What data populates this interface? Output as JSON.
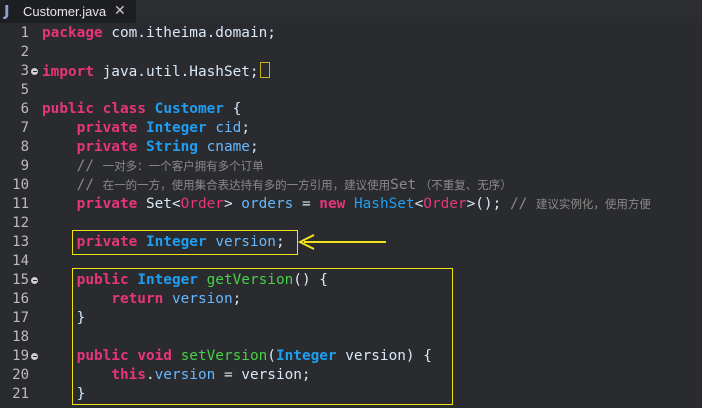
{
  "tab": {
    "icon": "J",
    "icon_name": "java-file-icon",
    "filename": "Customer.java",
    "close": "✕"
  },
  "colors": {
    "keyword": "#e8357a",
    "type": "#1f9ef2",
    "method": "#47d147",
    "comment": "#8a8a8a",
    "highlight": "#f2e21a"
  },
  "lines": [
    {
      "n": "1",
      "fold": false,
      "tokens": [
        {
          "t": "package",
          "c": "kw"
        },
        {
          "t": " com.itheima.domain;",
          "c": ""
        }
      ]
    },
    {
      "n": "2",
      "fold": false,
      "tokens": []
    },
    {
      "n": "3",
      "fold": true,
      "tokens": [
        {
          "t": "import",
          "c": "kw"
        },
        {
          "t": " java.util.HashSet;",
          "c": ""
        }
      ],
      "import_marker": true
    },
    {
      "n": "5",
      "fold": false,
      "tokens": []
    },
    {
      "n": "6",
      "fold": false,
      "tokens": [
        {
          "t": "public",
          "c": "kw"
        },
        {
          "t": " ",
          "c": ""
        },
        {
          "t": "class",
          "c": "kw"
        },
        {
          "t": " ",
          "c": ""
        },
        {
          "t": "Customer",
          "c": "ty-b"
        },
        {
          "t": " {",
          "c": ""
        }
      ]
    },
    {
      "n": "7",
      "fold": false,
      "tokens": [
        {
          "t": "    ",
          "c": ""
        },
        {
          "t": "private",
          "c": "kw"
        },
        {
          "t": " ",
          "c": ""
        },
        {
          "t": "Integer",
          "c": "ty-b"
        },
        {
          "t": " ",
          "c": ""
        },
        {
          "t": "cid",
          "c": "fld"
        },
        {
          "t": ";",
          "c": ""
        }
      ]
    },
    {
      "n": "8",
      "fold": false,
      "tokens": [
        {
          "t": "    ",
          "c": ""
        },
        {
          "t": "private",
          "c": "kw"
        },
        {
          "t": " ",
          "c": ""
        },
        {
          "t": "String",
          "c": "ty-b"
        },
        {
          "t": " ",
          "c": ""
        },
        {
          "t": "cname",
          "c": "fld"
        },
        {
          "t": ";",
          "c": ""
        }
      ]
    },
    {
      "n": "9",
      "fold": false,
      "tokens": [
        {
          "t": "    ",
          "c": ""
        },
        {
          "t": "// ",
          "c": "cm-mono"
        },
        {
          "t": "一对多：一个客户拥有多个订单",
          "c": "cm"
        }
      ]
    },
    {
      "n": "10",
      "fold": false,
      "tokens": [
        {
          "t": "    ",
          "c": ""
        },
        {
          "t": "// ",
          "c": "cm-mono"
        },
        {
          "t": "在一的一方，使用集合表达持有多的一方引用，建议使用",
          "c": "cm"
        },
        {
          "t": "Set",
          "c": "cm-mono"
        },
        {
          "t": " （不重复、无序）",
          "c": "cm"
        }
      ]
    },
    {
      "n": "11",
      "fold": false,
      "tokens": [
        {
          "t": "    ",
          "c": ""
        },
        {
          "t": "private",
          "c": "kw"
        },
        {
          "t": " Set<",
          "c": ""
        },
        {
          "t": "Order",
          "c": "gen"
        },
        {
          "t": "> ",
          "c": ""
        },
        {
          "t": "orders",
          "c": "fld"
        },
        {
          "t": " = ",
          "c": ""
        },
        {
          "t": "new",
          "c": "kw"
        },
        {
          "t": " ",
          "c": ""
        },
        {
          "t": "HashSet",
          "c": "ty"
        },
        {
          "t": "<",
          "c": ""
        },
        {
          "t": "Order",
          "c": "gen"
        },
        {
          "t": ">(); ",
          "c": ""
        },
        {
          "t": "// ",
          "c": "cm-mono"
        },
        {
          "t": "建议实例化，使用方便",
          "c": "cm"
        }
      ]
    },
    {
      "n": "12",
      "fold": false,
      "tokens": []
    },
    {
      "n": "13",
      "fold": false,
      "tokens": [
        {
          "t": "    ",
          "c": ""
        },
        {
          "t": "private",
          "c": "kw"
        },
        {
          "t": " ",
          "c": ""
        },
        {
          "t": "Integer",
          "c": "ty-b"
        },
        {
          "t": " ",
          "c": ""
        },
        {
          "t": "version",
          "c": "fld"
        },
        {
          "t": ";",
          "c": ""
        }
      ]
    },
    {
      "n": "14",
      "fold": false,
      "tokens": []
    },
    {
      "n": "15",
      "fold": true,
      "tokens": [
        {
          "t": "    ",
          "c": ""
        },
        {
          "t": "public",
          "c": "kw"
        },
        {
          "t": " ",
          "c": ""
        },
        {
          "t": "Integer",
          "c": "ty-b"
        },
        {
          "t": " ",
          "c": ""
        },
        {
          "t": "getVersion",
          "c": "fn"
        },
        {
          "t": "() {",
          "c": ""
        }
      ]
    },
    {
      "n": "16",
      "fold": false,
      "tokens": [
        {
          "t": "        ",
          "c": ""
        },
        {
          "t": "return",
          "c": "kw"
        },
        {
          "t": " ",
          "c": ""
        },
        {
          "t": "version",
          "c": "fld"
        },
        {
          "t": ";",
          "c": ""
        }
      ]
    },
    {
      "n": "17",
      "fold": false,
      "tokens": [
        {
          "t": "    }",
          "c": ""
        }
      ]
    },
    {
      "n": "18",
      "fold": false,
      "tokens": []
    },
    {
      "n": "19",
      "fold": true,
      "tokens": [
        {
          "t": "    ",
          "c": ""
        },
        {
          "t": "public",
          "c": "kw"
        },
        {
          "t": " ",
          "c": ""
        },
        {
          "t": "void",
          "c": "kw"
        },
        {
          "t": " ",
          "c": ""
        },
        {
          "t": "setVersion",
          "c": "fn"
        },
        {
          "t": "(",
          "c": ""
        },
        {
          "t": "Integer",
          "c": "ty-b"
        },
        {
          "t": " version) {",
          "c": ""
        }
      ]
    },
    {
      "n": "20",
      "fold": false,
      "tokens": [
        {
          "t": "        ",
          "c": ""
        },
        {
          "t": "this",
          "c": "kw"
        },
        {
          "t": ".",
          "c": ""
        },
        {
          "t": "version",
          "c": "fld"
        },
        {
          "t": " = version;",
          "c": ""
        }
      ]
    },
    {
      "n": "21",
      "fold": false,
      "tokens": [
        {
          "t": "    }",
          "c": ""
        }
      ]
    }
  ]
}
